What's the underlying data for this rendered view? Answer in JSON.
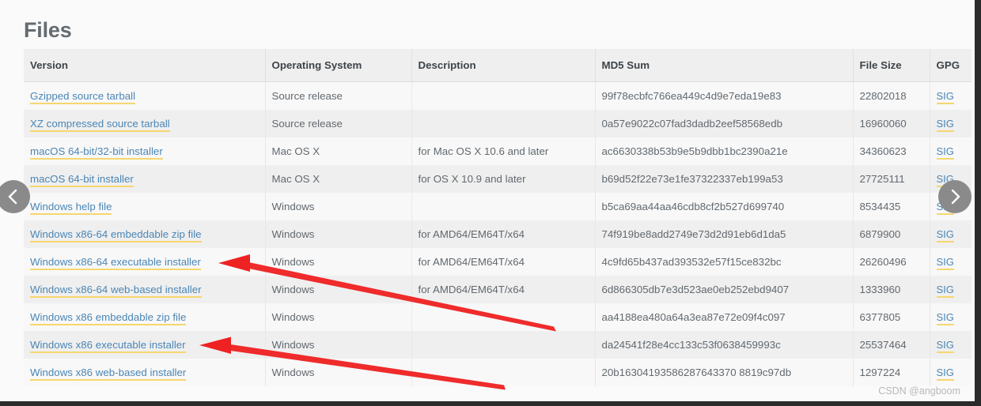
{
  "page": {
    "title": "Files",
    "watermark": "CSDN @angboom"
  },
  "table": {
    "columns": [
      "Version",
      "Operating System",
      "Description",
      "MD5 Sum",
      "File Size",
      "GPG"
    ],
    "gpg_label": "SIG",
    "rows": [
      {
        "version": "Gzipped source tarball",
        "os": "Source release",
        "description": "",
        "md5": "99f78ecbfc766ea449c4d9e7eda19e83",
        "size": "22802018",
        "gpg": "SIG"
      },
      {
        "version": "XZ compressed source tarball",
        "os": "Source release",
        "description": "",
        "md5": "0a57e9022c07fad3dadb2eef58568edb",
        "size": "16960060",
        "gpg": "SIG"
      },
      {
        "version": "macOS 64-bit/32-bit installer",
        "os": "Mac OS X",
        "description": "for Mac OS X 10.6 and later",
        "md5": "ac6630338b53b9e5b9dbb1bc2390a21e",
        "size": "34360623",
        "gpg": "SIG"
      },
      {
        "version": "macOS 64-bit installer",
        "os": "Mac OS X",
        "description": "for OS X 10.9 and later",
        "md5": "b69d52f22e73e1fe37322337eb199a53",
        "size": "27725111",
        "gpg": "SIG"
      },
      {
        "version": "Windows help file",
        "os": "Windows",
        "description": "",
        "md5": "b5ca69aa44aa46cdb8cf2b527d699740",
        "size": "8534435",
        "gpg": "SIG"
      },
      {
        "version": "Windows x86-64 embeddable zip file",
        "os": "Windows",
        "description": "for AMD64/EM64T/x64",
        "md5": "74f919be8add2749e73d2d91eb6d1da5",
        "size": "6879900",
        "gpg": "SIG"
      },
      {
        "version": "Windows x86-64 executable installer",
        "os": "Windows",
        "description": "for AMD64/EM64T/x64",
        "md5": "4c9fd65b437ad393532e57f15ce832bc",
        "size": "26260496",
        "gpg": "SIG"
      },
      {
        "version": "Windows x86-64 web-based installer",
        "os": "Windows",
        "description": "for AMD64/EM64T/x64",
        "md5": "6d866305db7e3d523ae0eb252ebd9407",
        "size": "1333960",
        "gpg": "SIG"
      },
      {
        "version": "Windows x86 embeddable zip file",
        "os": "Windows",
        "description": "",
        "md5": "aa4188ea480a64a3ea87e72e09f4c097",
        "size": "6377805",
        "gpg": "SIG"
      },
      {
        "version": "Windows x86 executable installer",
        "os": "Windows",
        "description": "",
        "md5": "da24541f28e4cc133c53f0638459993c",
        "size": "25537464",
        "gpg": "SIG"
      },
      {
        "version": "Windows x86 web-based installer",
        "os": "Windows",
        "description": "",
        "md5": "20b16304193586287643370 8819c97db",
        "size": "1297224",
        "gpg": "SIG"
      }
    ]
  },
  "carousel": {
    "prev_icon": "chevron-left-icon",
    "next_icon": "chevron-right-icon"
  },
  "annotations": {
    "arrow_color": "#ee2222",
    "arrows": [
      {
        "label": "arrow-to-windows-x86-64-executable-installer",
        "target": "Windows x86-64 executable installer"
      },
      {
        "label": "arrow-to-windows-x86-executable-installer",
        "target": "Windows x86 executable installer"
      }
    ]
  }
}
